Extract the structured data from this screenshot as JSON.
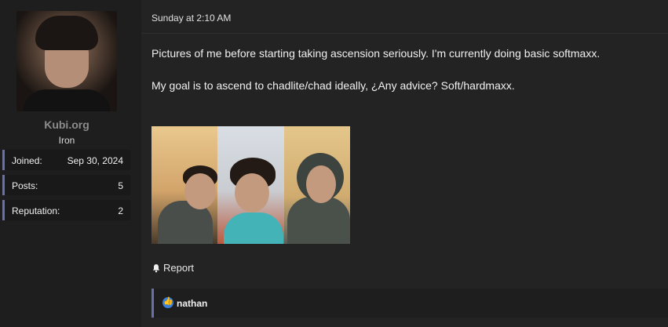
{
  "user": {
    "name": "Kubi.org",
    "rank": "Iron",
    "stats": [
      {
        "label": "Joined:",
        "value": "Sep 30, 2024"
      },
      {
        "label": "Posts:",
        "value": "5"
      },
      {
        "label": "Reputation:",
        "value": "2"
      }
    ]
  },
  "post": {
    "date": "Sunday at 2:10 AM",
    "line1": "Pictures of me before starting taking ascension seriously. I'm currently doing basic softmaxx.",
    "line2": "My goal is to ascend to chadlite/chad ideally, ¿Any advice? Soft/hardmaxx.",
    "report_label": "Report"
  },
  "reactions": {
    "icon": "like-icon",
    "users": "nathan"
  },
  "colors": {
    "accent": "#6a6fb0",
    "like": "#3b80d8"
  }
}
